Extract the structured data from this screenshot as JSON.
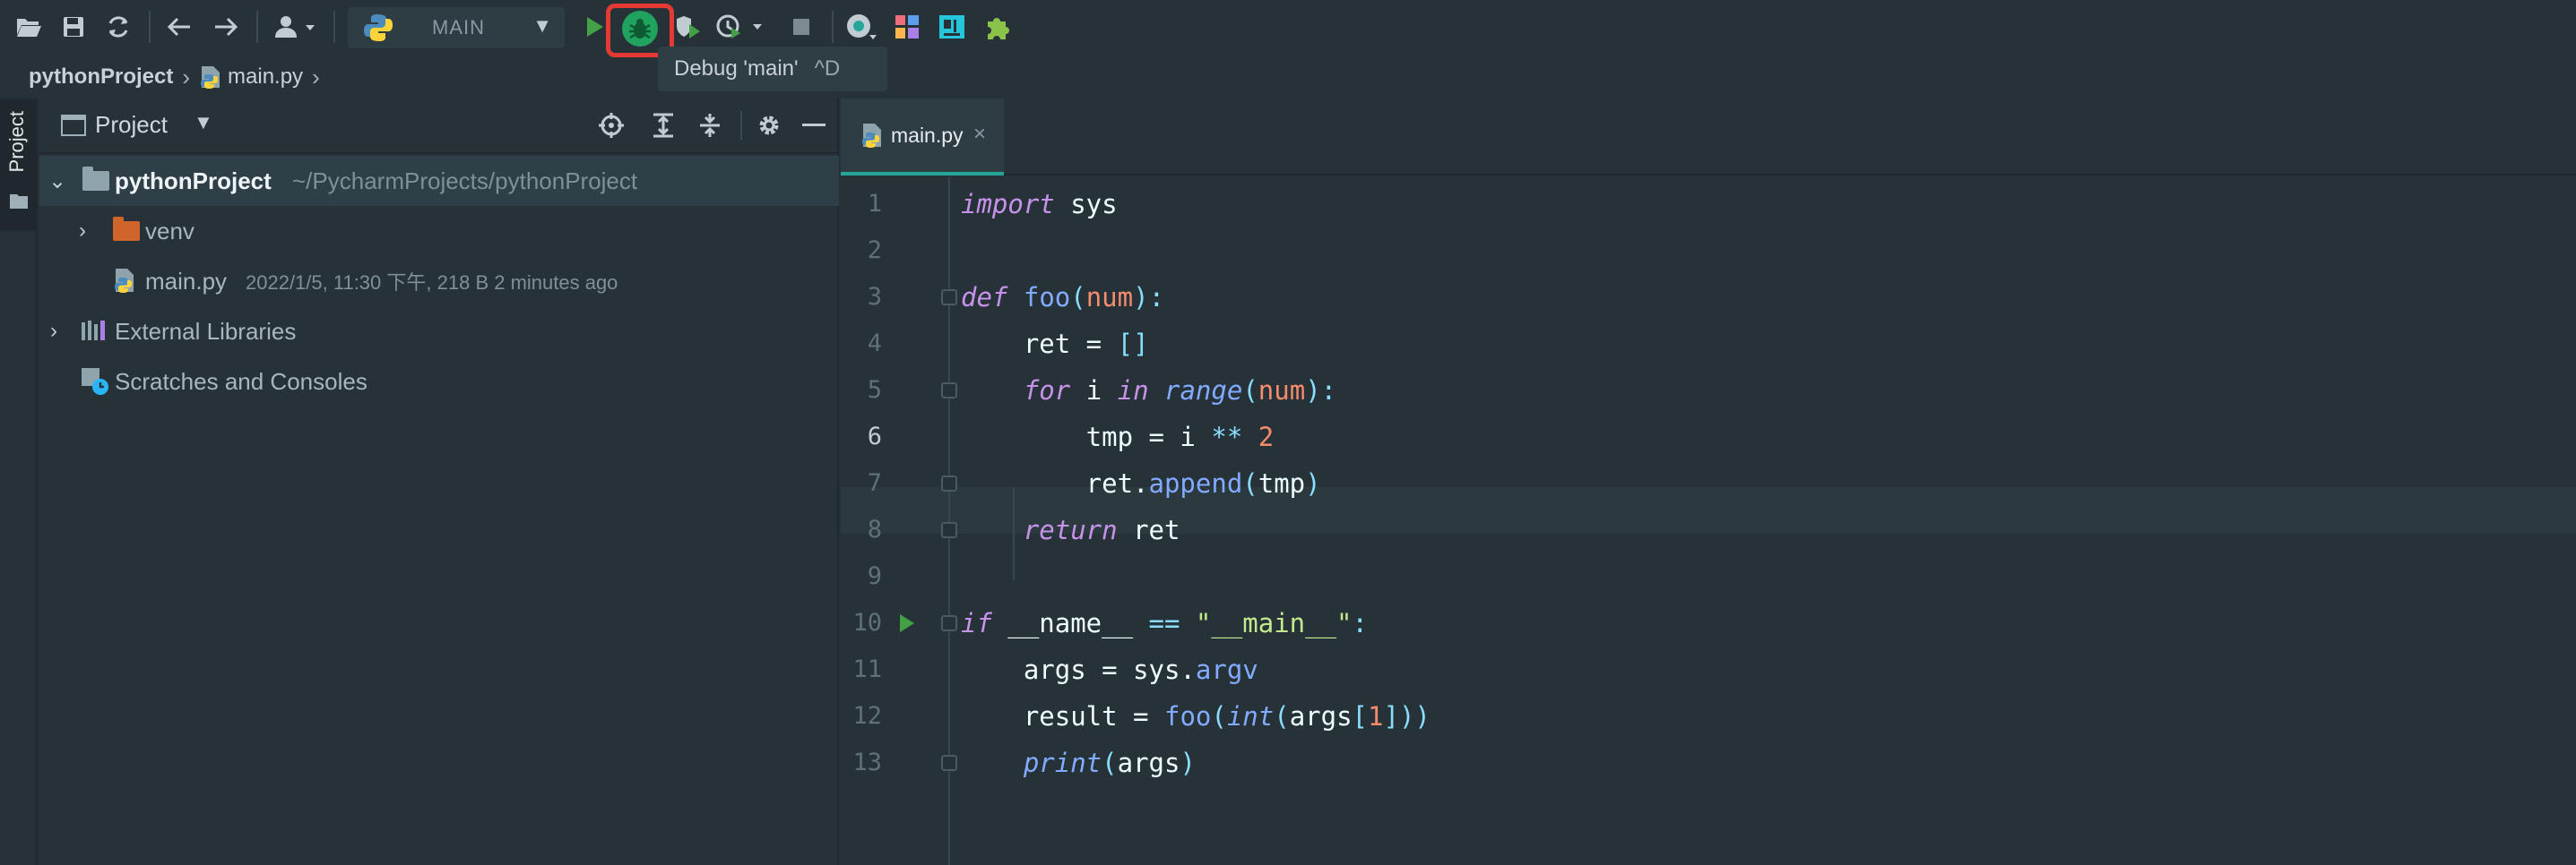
{
  "toolbar": {
    "run_config": "MAIN",
    "tooltip": {
      "label": "Debug 'main'",
      "shortcut": "^D"
    },
    "colors": {
      "run": "#43a047",
      "debug": "#1fa35f",
      "highlight": "#e53935"
    },
    "icons": [
      "open-folder-icon",
      "save-icon",
      "sync-icon",
      "back-icon",
      "forward-icon",
      "vcs-user-icon",
      "python-icon",
      "run-icon",
      "debug-icon",
      "coverage-icon",
      "profile-icon",
      "stop-icon",
      "record-icon",
      "layout-icon",
      "code-with-me-icon",
      "plugin-icon"
    ]
  },
  "breadcrumb": {
    "project": "pythonProject",
    "file": "main.py"
  },
  "sidebar": {
    "tab_label": "Project"
  },
  "project_panel": {
    "title": "Project",
    "tree": [
      {
        "label": "pythonProject",
        "detail": "~/PycharmProjects/pythonProject"
      },
      {
        "label": "venv",
        "detail": ""
      },
      {
        "label": "main.py",
        "detail": "2022/1/5, 11:30 下午, 218 B 2 minutes ago"
      },
      {
        "label": "External Libraries",
        "detail": ""
      },
      {
        "label": "Scratches and Consoles",
        "detail": ""
      }
    ]
  },
  "editor": {
    "tab": {
      "name": "main.py",
      "close": "×"
    },
    "current_line": 6,
    "lines": [
      {
        "n": "1",
        "text": "import sys"
      },
      {
        "n": "2",
        "text": ""
      },
      {
        "n": "3",
        "text": "def foo(num):"
      },
      {
        "n": "4",
        "text": "    ret = []"
      },
      {
        "n": "5",
        "text": "    for i in range(num):"
      },
      {
        "n": "6",
        "text": "        tmp = i ** 2"
      },
      {
        "n": "7",
        "text": "        ret.append(tmp)"
      },
      {
        "n": "8",
        "text": "    return ret"
      },
      {
        "n": "9",
        "text": ""
      },
      {
        "n": "10",
        "text": "if __name__ == \"__main__\":"
      },
      {
        "n": "11",
        "text": "    args = sys.argv"
      },
      {
        "n": "12",
        "text": "    result = foo(int(args[1]))"
      },
      {
        "n": "13",
        "text": "    print(args)"
      }
    ]
  }
}
